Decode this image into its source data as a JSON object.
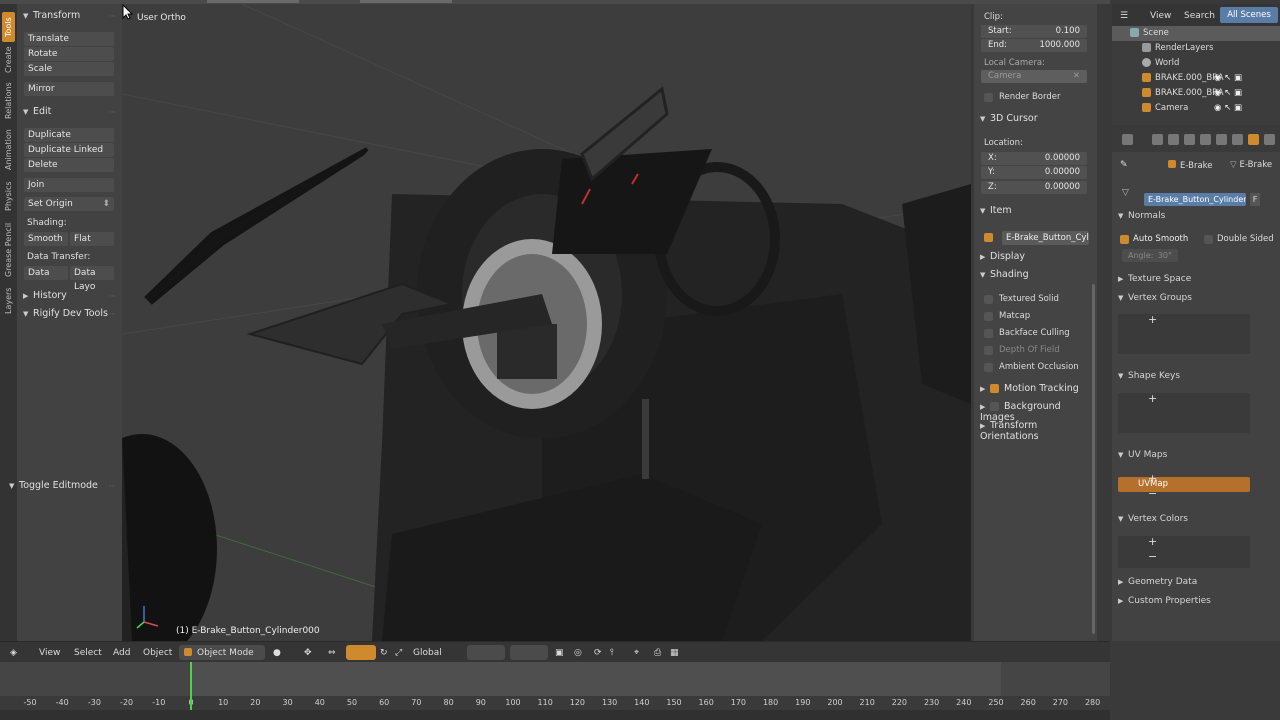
{
  "tool_shelf": {
    "tabs": [
      "Tools",
      "Create",
      "Relations",
      "Animation",
      "Physics",
      "Grease Pencil",
      "Layers"
    ],
    "transform_title": "Transform",
    "transform_buttons": [
      "Translate",
      "Rotate",
      "Scale"
    ],
    "mirror": "Mirror",
    "edit_title": "Edit",
    "edit_buttons": [
      "Duplicate",
      "Duplicate Linked",
      "Delete"
    ],
    "join": "Join",
    "set_origin": "Set Origin",
    "shading_label": "Shading:",
    "smooth": "Smooth",
    "flat": "Flat",
    "data_transfer_label": "Data Transfer:",
    "data": "Data",
    "data_layo": "Data Layo",
    "history": "History",
    "rigify": "Rigify Dev Tools",
    "toggle_editmode": "Toggle Editmode"
  },
  "viewport": {
    "title": "User Ortho",
    "object_label": "(1) E-Brake_Button_Cylinder000"
  },
  "n_panel": {
    "clip_label": "Clip:",
    "start_label": "Start:",
    "start_value": "0.100",
    "end_label": "End:",
    "end_value": "1000.000",
    "local_camera_label": "Local Camera:",
    "camera_value": "Camera",
    "render_border": "Render Border",
    "cursor_title": "3D Cursor",
    "location_label": "Location:",
    "x_label": "X:",
    "x_value": "0.00000",
    "y_label": "Y:",
    "y_value": "0.00000",
    "z_label": "Z:",
    "z_value": "0.00000",
    "item_title": "Item",
    "item_name": "E-Brake_Button_Cyl...",
    "display_title": "Display",
    "shading_title": "Shading",
    "textured_solid": "Textured Solid",
    "matcap": "Matcap",
    "backface_culling": "Backface Culling",
    "depth_of_field": "Depth Of Field",
    "ambient_occlusion": "Ambient Occlusion",
    "motion_tracking": "Motion Tracking",
    "background_images": "Background Images",
    "transform_orientations": "Transform Orientations"
  },
  "outliner": {
    "view": "View",
    "search": "Search",
    "all_scenes": "All Scenes",
    "rows": [
      "Scene",
      "RenderLayers",
      "World",
      "BRAKE.000_BRA",
      "BRAKE.000_BRA",
      "Camera"
    ]
  },
  "properties": {
    "crumb_1": "E-Brake",
    "crumb_2": "E-Brake",
    "mesh_name": "E-Brake_Button_Cylinder.0...",
    "mesh_suffix": "F",
    "normals": "Normals",
    "auto_smooth": "Auto Smooth",
    "double_sided": "Double Sided",
    "angle": "Angle:",
    "angle_value": "30°",
    "texture_space": "Texture Space",
    "vertex_groups": "Vertex Groups",
    "shape_keys": "Shape Keys",
    "uv_maps": "UV Maps",
    "uvmap": "UVMap",
    "vertex_colors": "Vertex Colors",
    "geometry_data": "Geometry Data",
    "custom_properties": "Custom Properties",
    "side_plus": "+",
    "side_minus": "−"
  },
  "header": {
    "view": "View",
    "select": "Select",
    "add": "Add",
    "object": "Object",
    "mode": "Object Mode",
    "orientation": "Global"
  },
  "timeline": {
    "ticks": [
      "-50",
      "-40",
      "-30",
      "-20",
      "-10",
      "0",
      "10",
      "20",
      "30",
      "40",
      "50",
      "60",
      "70",
      "80",
      "90",
      "100",
      "110",
      "120",
      "130",
      "140",
      "150",
      "160",
      "170",
      "180",
      "190",
      "200",
      "210",
      "220",
      "230",
      "240",
      "250",
      "260",
      "270",
      "280"
    ],
    "current_frame": 0
  },
  "colors": {
    "accent": "#d08a2e",
    "selection": "#5a7da8",
    "frame_cursor": "#4fd14f"
  }
}
